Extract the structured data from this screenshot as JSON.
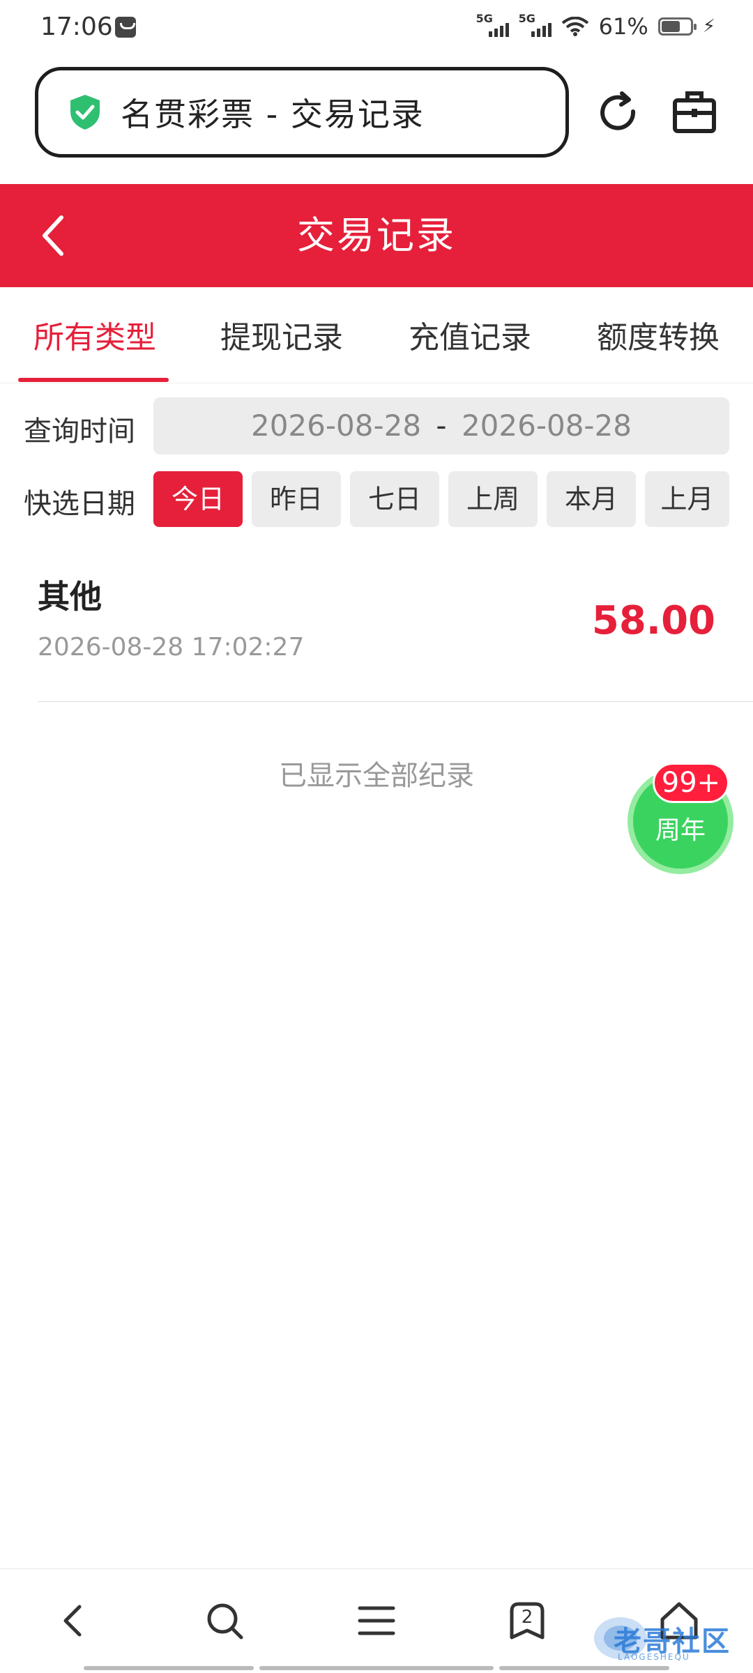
{
  "status_bar": {
    "time": "17:06",
    "network_1": "5G",
    "network_2": "5G",
    "battery": "61%"
  },
  "browser": {
    "address_text": "名贯彩票 - 交易记录"
  },
  "header": {
    "title": "交易记录"
  },
  "tabs": [
    {
      "label": "所有类型",
      "active": true
    },
    {
      "label": "提现记录",
      "active": false
    },
    {
      "label": "充值记录",
      "active": false
    },
    {
      "label": "额度转换",
      "active": false
    }
  ],
  "filters": {
    "query_label": "查询时间",
    "date_start": "2026-08-28",
    "date_sep": "-",
    "date_end": "2026-08-28",
    "quick_label": "快选日期",
    "quick_options": [
      "今日",
      "昨日",
      "七日",
      "上周",
      "本月",
      "上月"
    ],
    "quick_selected": "今日"
  },
  "records": [
    {
      "title": "其他",
      "time": "2026-08-28 17:02:27",
      "amount": "58.00"
    }
  ],
  "footer_text": "已显示全部纪录",
  "floating": {
    "badge": "99+",
    "label": "周年"
  },
  "bottom_nav": {
    "tab_count": "2"
  },
  "watermark": {
    "text": "老哥社区",
    "sub": "LAOGESHEQU"
  },
  "colors": {
    "accent": "#e6203a",
    "shield": "#2fbf71",
    "anniversary": "#3bd35f"
  },
  "icons": [
    "shield-check-icon",
    "reload-icon",
    "toolbox-icon",
    "back-arrow-icon",
    "search-icon",
    "menu-icon",
    "tabs-icon",
    "home-icon"
  ]
}
